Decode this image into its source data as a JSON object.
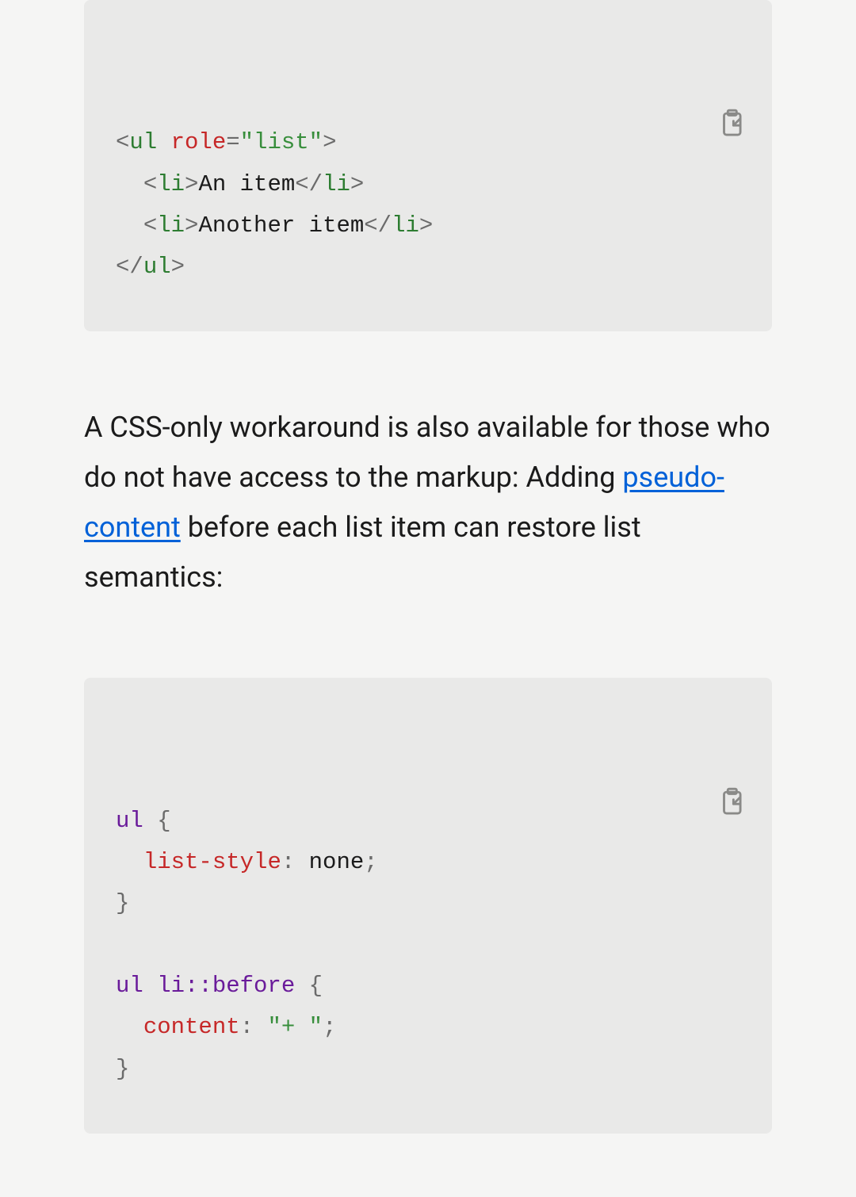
{
  "code1": {
    "l1": {
      "ul": "ul",
      "role": "role",
      "list": "\"list\""
    },
    "l2": {
      "li_open": "li",
      "text": "An item",
      "li_close": "li"
    },
    "l3": {
      "li_open": "li",
      "text": "Another item",
      "li_close": "li"
    },
    "l4": {
      "ul_close": "ul"
    }
  },
  "para": {
    "t1": "A CSS-only workaround is also available for those who do not have access to the markup: Adding ",
    "link": "pseudo-content",
    "t2": " before each list item can restore list semantics:"
  },
  "code2": {
    "l1": {
      "sel": "ul",
      "brace": " {"
    },
    "l2": {
      "prop": "list-style",
      "colon": ":",
      "val": " none",
      "semi": ";"
    },
    "l3": {
      "brace": "}"
    },
    "l4": {
      "sel": "ul li",
      "pseudo": "::before",
      "brace": " {"
    },
    "l5": {
      "prop": "content",
      "colon": ":",
      "val": " \"+ \"",
      "semi": ";"
    },
    "l6": {
      "brace": "}"
    }
  }
}
